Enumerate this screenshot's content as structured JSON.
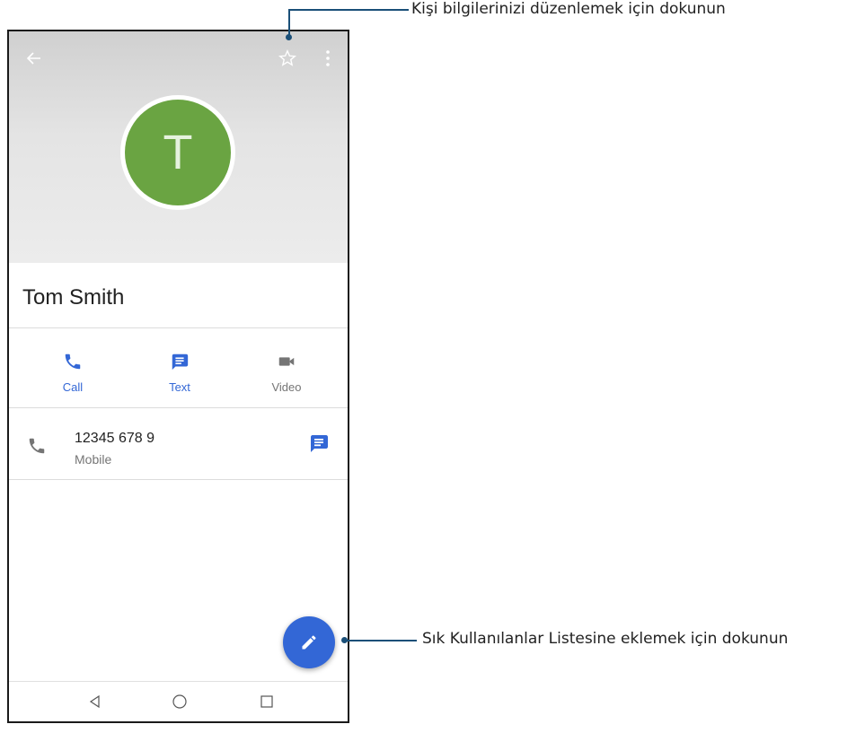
{
  "contact": {
    "avatar_letter": "T",
    "name": "Tom Smith"
  },
  "topbar": {
    "back_icon": "arrow-left-icon",
    "star_icon": "star-outline-icon",
    "menu_icon": "more-vert-icon"
  },
  "actions": [
    {
      "label": "Call",
      "icon": "phone-icon",
      "color": "#3367d6"
    },
    {
      "label": "Text",
      "icon": "message-icon",
      "color": "#3367d6"
    },
    {
      "label": "Video",
      "icon": "videocam-icon",
      "color": "#757575"
    }
  ],
  "phone_entry": {
    "number": "12345 678 9",
    "type": "Mobile"
  },
  "callouts": {
    "top": "Kişi bilgilerinizi düzenlemek için dokunun",
    "bottom": "Sık Kullanılanlar Listesine eklemek için dokunun"
  },
  "colors": {
    "accent": "#3367d6",
    "avatar": "#6aa442",
    "callout_line": "#1a4f78"
  }
}
